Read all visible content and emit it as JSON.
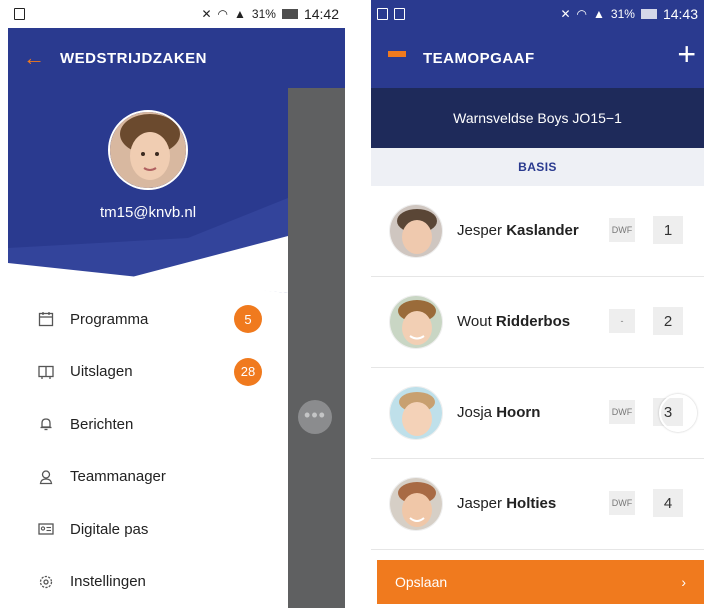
{
  "left_screen": {
    "status_bar": {
      "battery": "31%",
      "time": "14:42"
    },
    "app_bar": {
      "title": "WEDSTRIJDZAKEN",
      "back_icon": "arrow-left-icon"
    },
    "profile": {
      "email": "tm15@knvb.nl",
      "avatar_icon": "user-avatar"
    },
    "menu": [
      {
        "label": "Programma",
        "icon": "calendar-icon",
        "badge": "5"
      },
      {
        "label": "Uitslagen",
        "icon": "scoreboard-icon",
        "badge": "28"
      },
      {
        "label": "Berichten",
        "icon": "bell-icon",
        "badge": ""
      },
      {
        "label": "Teammanager",
        "icon": "person-icon",
        "badge": ""
      },
      {
        "label": "Digitale pas",
        "icon": "id-card-icon",
        "badge": ""
      },
      {
        "label": "Instellingen",
        "icon": "gear-icon",
        "badge": ""
      }
    ],
    "overlay_dots": "•••"
  },
  "right_screen": {
    "status_bar": {
      "battery": "31%",
      "time": "14:43"
    },
    "app_bar": {
      "title": "TEAMOPGAAF",
      "menu_icon": "hamburger-icon",
      "add_icon": "plus-icon"
    },
    "team": "Warnsveldse Boys JO15−1",
    "section": "BASIS",
    "players": [
      {
        "first": "Jesper",
        "last": "Kaslander",
        "tag": "DWF",
        "number": "1"
      },
      {
        "first": "Wout",
        "last": "Ridderbos",
        "tag": "-",
        "number": "2"
      },
      {
        "first": "Josja",
        "last": "Hoorn",
        "tag": "DWF",
        "number": "3"
      },
      {
        "first": "Jasper",
        "last": "Holties",
        "tag": "DWF",
        "number": "4"
      }
    ],
    "save_button": {
      "label": "Opslaan",
      "chevron": "›"
    }
  },
  "colors": {
    "brand_blue": "#2a3a8f",
    "dark_blue": "#1e2a5a",
    "accent_orange": "#f07a1e"
  }
}
